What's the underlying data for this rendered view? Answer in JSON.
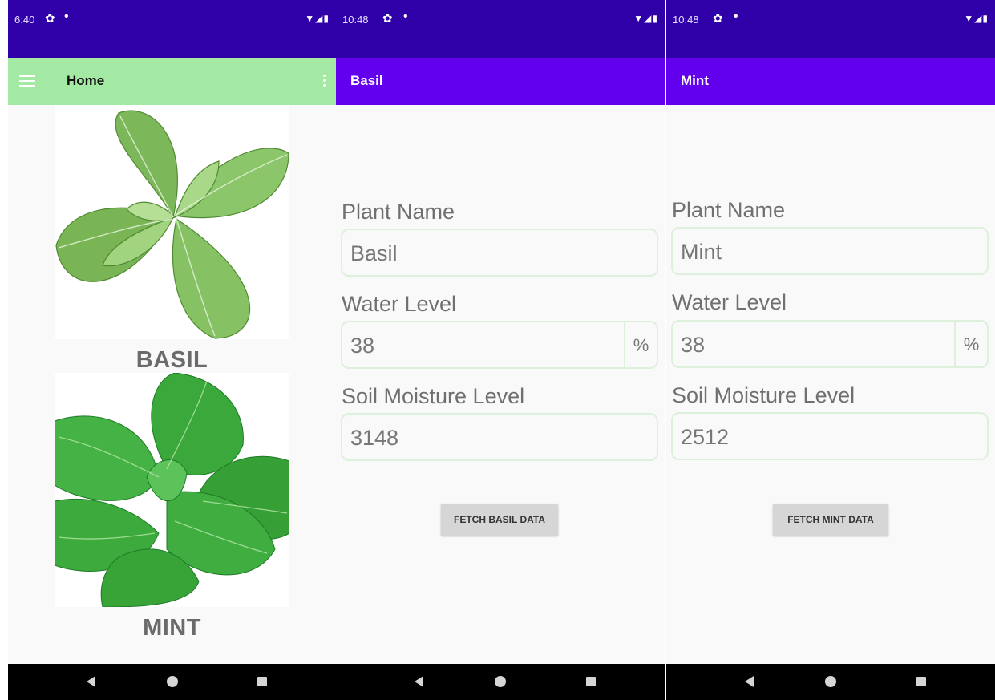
{
  "screens": [
    {
      "status": {
        "time": "6:40"
      },
      "appbar": {
        "title": "Home"
      },
      "plants": [
        {
          "label": "BASIL"
        },
        {
          "label": "MINT"
        }
      ]
    },
    {
      "status": {
        "time": "10:48"
      },
      "appbar": {
        "title": "Basil"
      },
      "form": {
        "plant_name_label": "Plant Name",
        "plant_name_value": "Basil",
        "water_level_label": "Water Level",
        "water_level_value": "38",
        "water_level_suffix": "%",
        "soil_moisture_label": "Soil Moisture Level",
        "soil_moisture_value": "3148"
      },
      "fetch_button": "FETCH BASIL DATA"
    },
    {
      "status": {
        "time": "10:48"
      },
      "appbar": {
        "title": "Mint"
      },
      "form": {
        "plant_name_label": "Plant Name",
        "plant_name_value": "Mint",
        "water_level_label": "Water Level",
        "water_level_value": "38",
        "water_level_suffix": "%",
        "soil_moisture_label": "Soil Moisture Level",
        "soil_moisture_value": "2512"
      },
      "fetch_button": "FETCH MINT DATA"
    }
  ],
  "icons": {
    "statusbar": [
      "settings-icon",
      "notification-dot-icon",
      "wifi-icon",
      "signal-icon",
      "battery-icon"
    ],
    "appbar": [
      "menu-icon",
      "overflow-menu-icon"
    ],
    "navbar": [
      "back-icon",
      "home-icon",
      "recents-icon"
    ]
  },
  "colors": {
    "status_bar": "#2f00a8",
    "home_app_bar": "#a3e9a3",
    "detail_app_bar": "#6200ee",
    "background": "#f9f9f9",
    "field_border": "#dcf0dc",
    "button": "#d6d6d6",
    "nav_bar": "#000000"
  }
}
